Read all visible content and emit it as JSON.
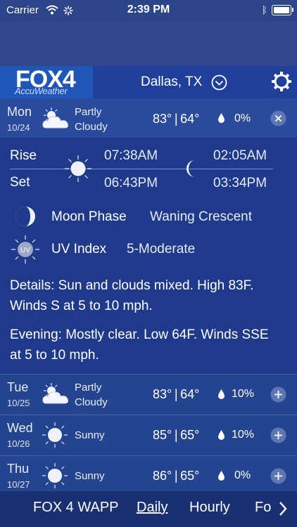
{
  "status_bar": {
    "carrier": "Carrier",
    "time": "2:39 PM"
  },
  "header": {
    "logo_main": "FOX4",
    "logo_sub": "AccuWeather",
    "location": "Dallas, TX"
  },
  "today": {
    "day": "Mon",
    "date": "10/24",
    "condition_line1": "Partly",
    "condition_line2": "Cloudy",
    "temps": "83° | 64°",
    "precip": "0%"
  },
  "sun_moon": {
    "rise_label": "Rise",
    "set_label": "Set",
    "sunrise": "07:38AM",
    "sunset": "06:43PM",
    "moonrise": "02:05AM",
    "moonset": "03:34PM"
  },
  "moon_phase": {
    "label": "Moon Phase",
    "value": "Waning Crescent"
  },
  "uv_index": {
    "label": "UV Index",
    "value": "5-Moderate",
    "icon_text": "UV"
  },
  "details": "Details: Sun and clouds mixed. High 83F. Winds S at 5 to 10 mph.",
  "evening": "Evening: Mostly clear. Low 64F. Winds SSE at 5 to 10 mph.",
  "forecast": [
    {
      "day": "Tue",
      "date": "10/25",
      "condition_line1": "Partly",
      "condition_line2": "Cloudy",
      "temps": "83° | 64°",
      "precip": "10%",
      "icon": "partly-cloudy-icon"
    },
    {
      "day": "Wed",
      "date": "10/26",
      "condition_line1": "Sunny",
      "condition_line2": "",
      "temps": "85° | 65°",
      "precip": "10%",
      "icon": "sun-icon"
    },
    {
      "day": "Thu",
      "date": "10/27",
      "condition_line1": "Sunny",
      "condition_line2": "",
      "temps": "86° | 65°",
      "precip": "0%",
      "icon": "sun-icon"
    }
  ],
  "nav": {
    "items": [
      "FOX 4 WAPP",
      "Daily",
      "Hourly",
      "Fo"
    ],
    "active": "Daily"
  },
  "colors": {
    "background": "#233a78",
    "header": "#1f3f9b",
    "logo_bg": "#2056b8",
    "nav": "#193173"
  }
}
